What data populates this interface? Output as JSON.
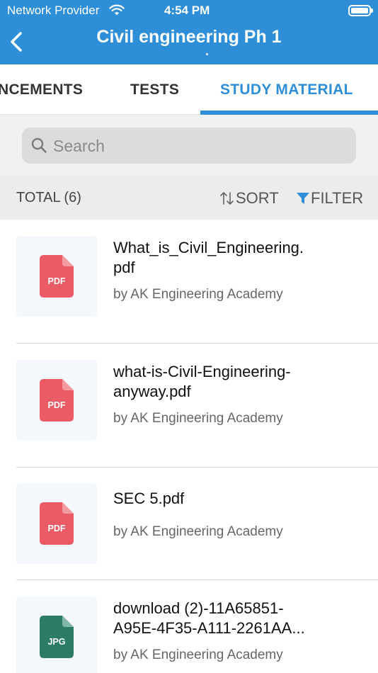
{
  "status_bar": {
    "carrier": "Network Provider",
    "time": "4:54 PM"
  },
  "nav": {
    "title": "Civil engineering Ph 1"
  },
  "tabs": [
    {
      "label": "NCEMENTS",
      "active": false
    },
    {
      "label": "TESTS",
      "active": false
    },
    {
      "label": "STUDY MATERIAL",
      "active": true
    }
  ],
  "search": {
    "placeholder": "Search",
    "value": ""
  },
  "toolbar": {
    "total_label": "TOTAL (6)",
    "sort_label": "SORT",
    "filter_label": "FILTER"
  },
  "files": [
    {
      "name": "What_is_Civil_Engineering.\npdf",
      "by": "by AK Engineering Academy",
      "type": "PDF"
    },
    {
      "name": "what-is-Civil-Engineering-\nanyway.pdf",
      "by": "by AK Engineering Academy",
      "type": "PDF"
    },
    {
      "name": "SEC 5.pdf",
      "by": "by AK Engineering Academy",
      "type": "PDF"
    },
    {
      "name": "download (2)-11A65851-\nA95E-4F35-A111-2261AA...",
      "by": "by AK Engineering Academy",
      "type": "JPG"
    }
  ],
  "colors": {
    "brand": "#2e8fd8",
    "pdf": "#ea5b66",
    "jpg": "#2c7b66"
  }
}
